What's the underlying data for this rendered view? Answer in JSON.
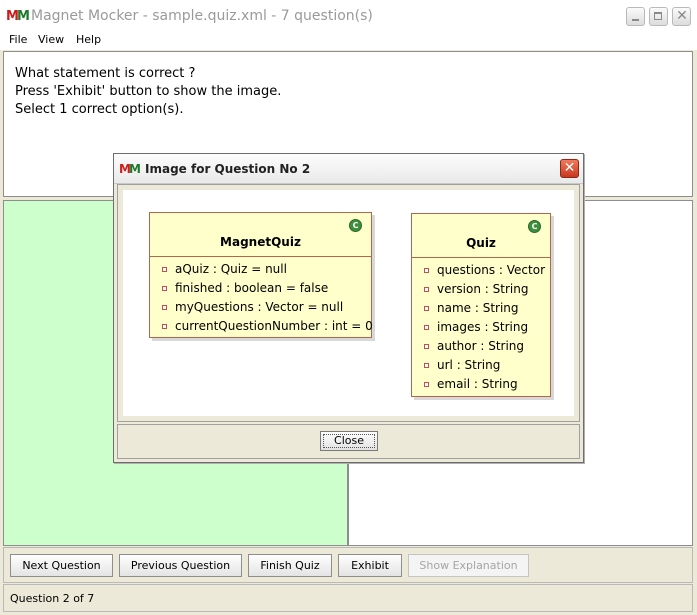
{
  "window": {
    "logo": {
      "m1": "M",
      "m2": "M"
    },
    "title": "Magnet Mocker - sample.quiz.xml - 7 question(s)",
    "minimize_icon": "minimize-icon",
    "maximize_icon": "maximize-icon",
    "close_icon": "close-icon"
  },
  "menu": {
    "file": "File",
    "view": "View",
    "help": "Help"
  },
  "question": {
    "line1": "What statement is correct ?",
    "line2": "Press 'Exhibit' button to show the image.",
    "line3": "Select 1 correct option(s)."
  },
  "buttons": {
    "next": "Next Question",
    "previous": "Previous Question",
    "finish": "Finish Quiz",
    "exhibit": "Exhibit",
    "explanation": "Show Explanation"
  },
  "status": "Question 2 of 7",
  "dialog": {
    "logo": {
      "m1": "M",
      "m2": "M"
    },
    "title": "Image for Question No 2",
    "close_glyph": "✕",
    "close_button": "Close",
    "classes": [
      {
        "name": "MagnetQuiz",
        "badge": "C",
        "attributes": [
          "aQuiz : Quiz = null",
          "finished : boolean = false",
          "myQuestions : Vector = null",
          "currentQuestionNumber : int = 0"
        ]
      },
      {
        "name": "Quiz",
        "badge": "C",
        "attributes": [
          "questions : Vector",
          "version : String",
          "name : String",
          "images : String",
          "author : String",
          "url : String",
          "email : String"
        ]
      }
    ]
  },
  "colors": {
    "options_left_bg": "#ccffcc",
    "uml_fill": "#ffffcc",
    "uml_border": "#b2664d",
    "logo_red": "#d11a1a",
    "logo_green": "#1d7a2a"
  }
}
